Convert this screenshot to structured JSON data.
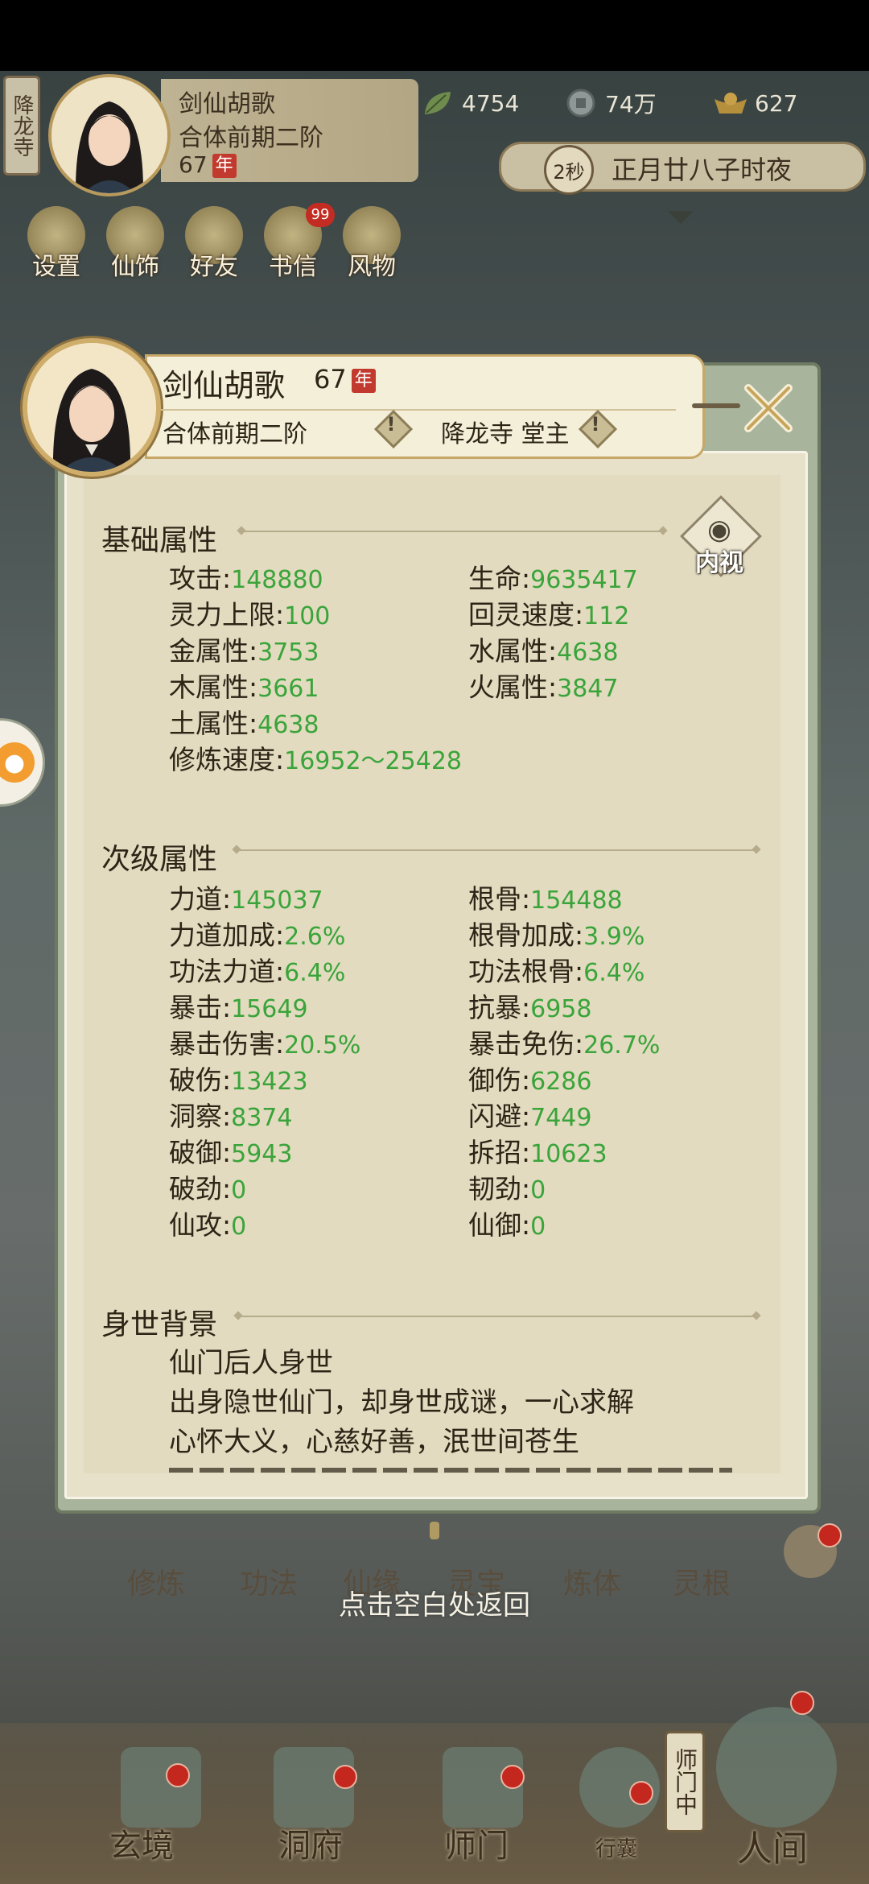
{
  "hud": {
    "location": "降龙寺",
    "name": "剑仙胡歌",
    "realm": "合体前期二阶",
    "age": "67",
    "age_unit": "年",
    "resources": [
      {
        "icon": "leaf-icon",
        "value": "4754"
      },
      {
        "icon": "coin-icon",
        "value": "74万"
      },
      {
        "icon": "ingot-icon",
        "value": "627"
      }
    ],
    "time_seconds": "2秒",
    "time_text": "正月廿八子时夜"
  },
  "menu": [
    {
      "label": "设置"
    },
    {
      "label": "仙饰"
    },
    {
      "label": "好友"
    },
    {
      "label": "书信",
      "badge": "99"
    },
    {
      "label": "风物"
    }
  ],
  "panel": {
    "name": "剑仙胡歌",
    "age": "67",
    "age_unit": "年",
    "realm": "合体前期二阶",
    "sect": "降龙寺 堂主",
    "inner_view": "内视",
    "basic_title": "基础属性",
    "basic": [
      {
        "label": "攻击",
        "value": "148880"
      },
      {
        "label": "生命",
        "value": "9635417"
      },
      {
        "label": "灵力上限",
        "value": "100"
      },
      {
        "label": "回灵速度",
        "value": "112"
      },
      {
        "label": "金属性",
        "value": "3753"
      },
      {
        "label": "水属性",
        "value": "4638"
      },
      {
        "label": "木属性",
        "value": "3661"
      },
      {
        "label": "火属性",
        "value": "3847"
      },
      {
        "label": "土属性",
        "value": "4638"
      },
      {
        "label": "修炼速度",
        "value": "16952～25428"
      }
    ],
    "secondary_title": "次级属性",
    "secondary": [
      {
        "label": "力道",
        "value": "145037"
      },
      {
        "label": "根骨",
        "value": "154488"
      },
      {
        "label": "力道加成",
        "value": "2.6%"
      },
      {
        "label": "根骨加成",
        "value": "3.9%"
      },
      {
        "label": "功法力道",
        "value": "6.4%"
      },
      {
        "label": "功法根骨",
        "value": "6.4%"
      },
      {
        "label": "暴击",
        "value": "15649"
      },
      {
        "label": "抗暴",
        "value": "6958"
      },
      {
        "label": "暴击伤害",
        "value": "20.5%"
      },
      {
        "label": "暴击免伤",
        "value": "26.7%"
      },
      {
        "label": "破伤",
        "value": "13423"
      },
      {
        "label": "御伤",
        "value": "6286"
      },
      {
        "label": "洞察",
        "value": "8374"
      },
      {
        "label": "闪避",
        "value": "7449"
      },
      {
        "label": "破御",
        "value": "5943"
      },
      {
        "label": "拆招",
        "value": "10623"
      },
      {
        "label": "破劲",
        "value": "0"
      },
      {
        "label": "韧劲",
        "value": "0"
      },
      {
        "label": "仙攻",
        "value": "0"
      },
      {
        "label": "仙御",
        "value": "0"
      }
    ],
    "background_title": "身世背景",
    "background_lines": [
      "仙门后人身世",
      "出身隐世仙门，却身世成谜，一心求解",
      "心怀大义，心慈好善，泯世间苍生"
    ]
  },
  "functions": [
    "修炼",
    "功法",
    "仙缘",
    "灵宝",
    "炼体",
    "灵根"
  ],
  "hint": "点击空白处返回",
  "nav": [
    {
      "label": "玄境"
    },
    {
      "label": "洞府"
    },
    {
      "label": "师门"
    },
    {
      "label": "行囊"
    },
    {
      "label": "人间"
    }
  ],
  "sect_tag": "师门中",
  "colors": {
    "stat_value": "#3aa43a",
    "accent_red": "#c23a2d",
    "panel_bg": "#e2dbc0"
  }
}
